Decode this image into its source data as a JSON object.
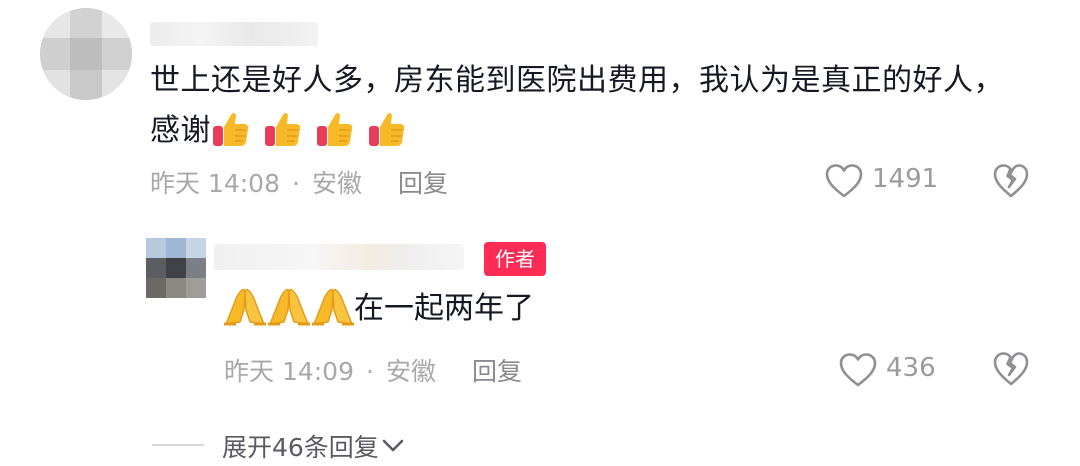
{
  "comment": {
    "text_line1": "世上还是好人多，房东能到医院出费用，我认为是真正的好人，",
    "text_line2": "感谢",
    "emojis": [
      "thumbs-up-icon",
      "thumbs-up-icon",
      "thumbs-up-icon",
      "thumbs-up-icon"
    ],
    "time": "昨天 14:08",
    "location": "安徽",
    "separator": "·",
    "reply_label": "回复",
    "like_count": "1491"
  },
  "reply": {
    "badge": "作者",
    "emojis": [
      "folded-hands-icon",
      "folded-hands-icon",
      "folded-hands-icon"
    ],
    "text": "在一起两年了",
    "time": "昨天 14:09",
    "location": "安徽",
    "separator": "·",
    "reply_label": "回复",
    "like_count": "436"
  },
  "expand": {
    "label": "展开46条回复"
  },
  "colors": {
    "badge": "#fe2c55",
    "text": "#161823",
    "meta": "#a8a8ac"
  }
}
